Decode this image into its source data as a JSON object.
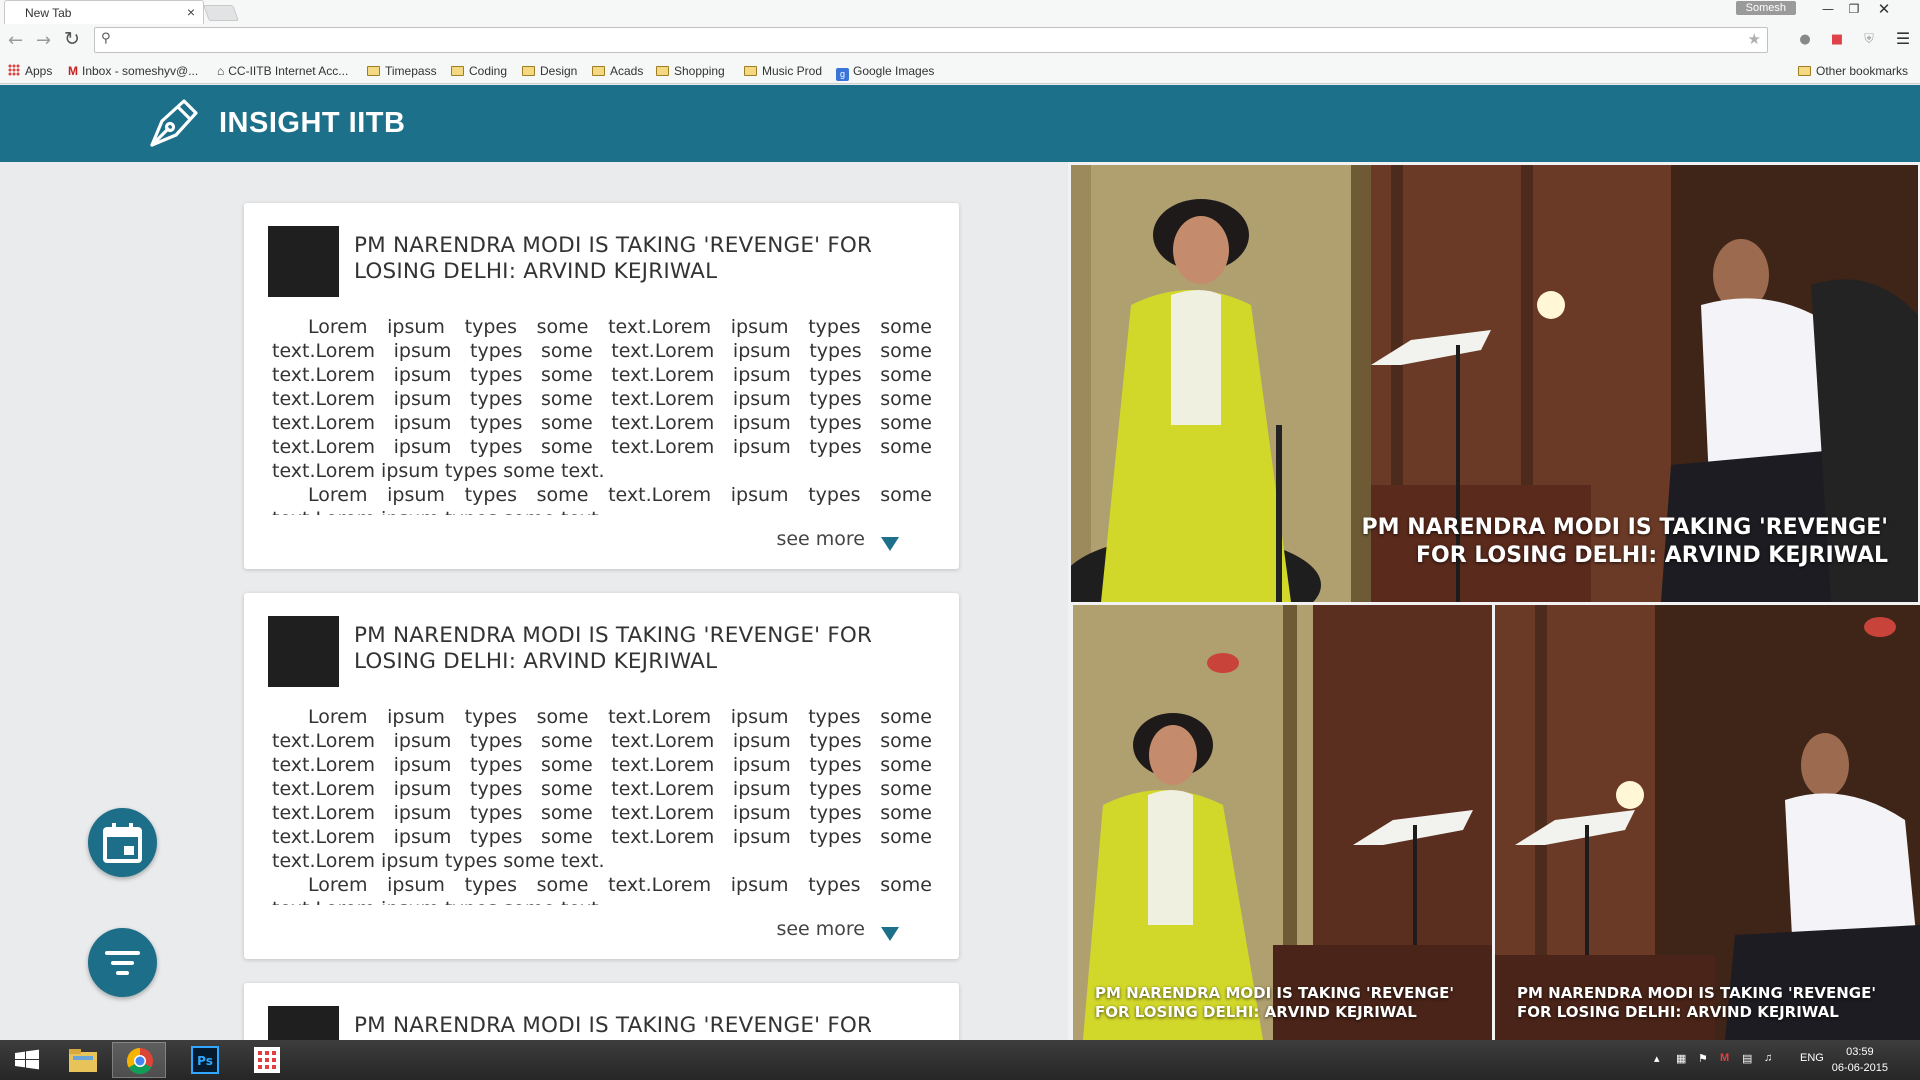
{
  "browser": {
    "tab_title": "New Tab",
    "tab_close": "×",
    "profile_name": "Somesh",
    "omnibox_value": "",
    "bookmarks": [
      {
        "label": "Apps",
        "icon": "apps-grid-icon"
      },
      {
        "label": "Inbox - someshyv@...",
        "icon": "gmail-icon"
      },
      {
        "label": "CC-IITB Internet Acc...",
        "icon": "building-icon"
      },
      {
        "label": "Timepass",
        "icon": "folder-icon"
      },
      {
        "label": "Coding",
        "icon": "folder-icon"
      },
      {
        "label": "Design",
        "icon": "folder-icon"
      },
      {
        "label": "Acads",
        "icon": "folder-icon"
      },
      {
        "label": "Shopping",
        "icon": "folder-icon"
      },
      {
        "label": "Music Prod",
        "icon": "folder-icon"
      },
      {
        "label": "Google Images",
        "icon": "google-images-icon"
      }
    ],
    "other_bookmarks": "Other bookmarks"
  },
  "site": {
    "title": "INSIGHT IITB",
    "header_color": "#1d7089"
  },
  "articles": [
    {
      "title": "PM NARENDRA MODI IS TAKING 'REVENGE' FOR LOSING DELHI: ARVIND KEJRIWAL",
      "paragraph_1": "Lorem ipsum types some text.Lorem ipsum types some text.Lorem ipsum types some text.Lorem ipsum types some text.Lorem ipsum types some text.Lorem ipsum types some text.Lorem ipsum types some text.Lorem ipsum types some text.Lorem ipsum types some text.Lorem ipsum types some text.Lorem ipsum types some text.Lorem ipsum types some text.Lorem ipsum types some text.",
      "paragraph_2": "Lorem ipsum types some text.Lorem ipsum types some text.Lorem ipsum types some text.",
      "see_more": "see more"
    },
    {
      "title": "PM NARENDRA MODI IS TAKING 'REVENGE' FOR LOSING DELHI: ARVIND KEJRIWAL",
      "paragraph_1": "Lorem ipsum types some text.Lorem ipsum types some text.Lorem ipsum types some text.Lorem ipsum types some text.Lorem ipsum types some text.Lorem ipsum types some text.Lorem ipsum types some text.Lorem ipsum types some text.Lorem ipsum types some text.Lorem ipsum types some text.Lorem ipsum types some text.Lorem ipsum types some text.Lorem ipsum types some text.",
      "paragraph_2": "Lorem ipsum types some text.Lorem ipsum types some text.Lorem ipsum types some text.",
      "see_more": "see more"
    },
    {
      "title": "PM NARENDRA MODI IS TAKING 'REVENGE' FOR LOSING DELHI: ARVIND KEJRIWAL"
    }
  ],
  "fabs": [
    {
      "icon": "calendar-icon"
    },
    {
      "icon": "filter-icon"
    }
  ],
  "featured": {
    "main_caption": "PM NARENDRA MODI IS TAKING 'REVENGE' FOR LOSING DELHI: ARVIND KEJRIWAL",
    "left_caption": "PM NARENDRA MODI IS TAKING 'REVENGE' FOR LOSING DELHI: ARVIND KEJRIWAL",
    "right_caption": "PM NARENDRA MODI IS TAKING 'REVENGE' FOR LOSING DELHI: ARVIND KEJRIWAL"
  },
  "taskbar": {
    "apps": [
      "windows-start-icon",
      "file-explorer-icon",
      "chrome-icon",
      "photoshop-icon",
      "app-grid-icon"
    ],
    "photoshop_label": "Ps",
    "language": "ENG",
    "time": "03:59",
    "date": "06-06-2015"
  }
}
